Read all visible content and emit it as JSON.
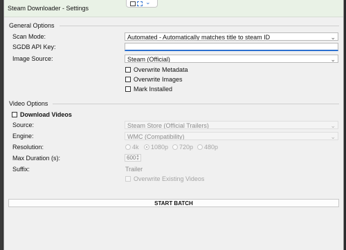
{
  "window": {
    "title": "Steam Downloader - Settings"
  },
  "general": {
    "group_label": "General Options",
    "scan_mode_label": "Scan Mode:",
    "scan_mode_value": "Automated - Automatically matches title to steam ID",
    "sgdb_label": "SGDB API Key:",
    "sgdb_value": "",
    "image_source_label": "Image Source:",
    "image_source_value": "Steam (Official)",
    "overwrite_metadata": "Overwrite Metadata",
    "overwrite_images": "Overwrite Images",
    "mark_installed": "Mark Installed"
  },
  "video": {
    "group_label": "Video Options",
    "download_videos": "Download Videos",
    "source_label": "Source:",
    "source_value": "Steam Store (Official Trailers)",
    "engine_label": "Engine:",
    "engine_value": "WMC (Compatibility)",
    "resolution_label": "Resolution:",
    "res_options": [
      "4k",
      "1080p",
      "720p",
      "480p"
    ],
    "res_selected": "1080p",
    "max_duration_label": "Max Duration (s):",
    "max_duration_value": "600",
    "suffix_label": "Suffix:",
    "suffix_value": "Trailer",
    "overwrite_existing_videos": "Overwrite Existing Videos"
  },
  "actions": {
    "start_batch": "START BATCH"
  },
  "icons": {
    "dropdown": "chevron-down-icon",
    "snap": "snap-layout-icon",
    "spinner": "spinner-arrows-icon"
  }
}
